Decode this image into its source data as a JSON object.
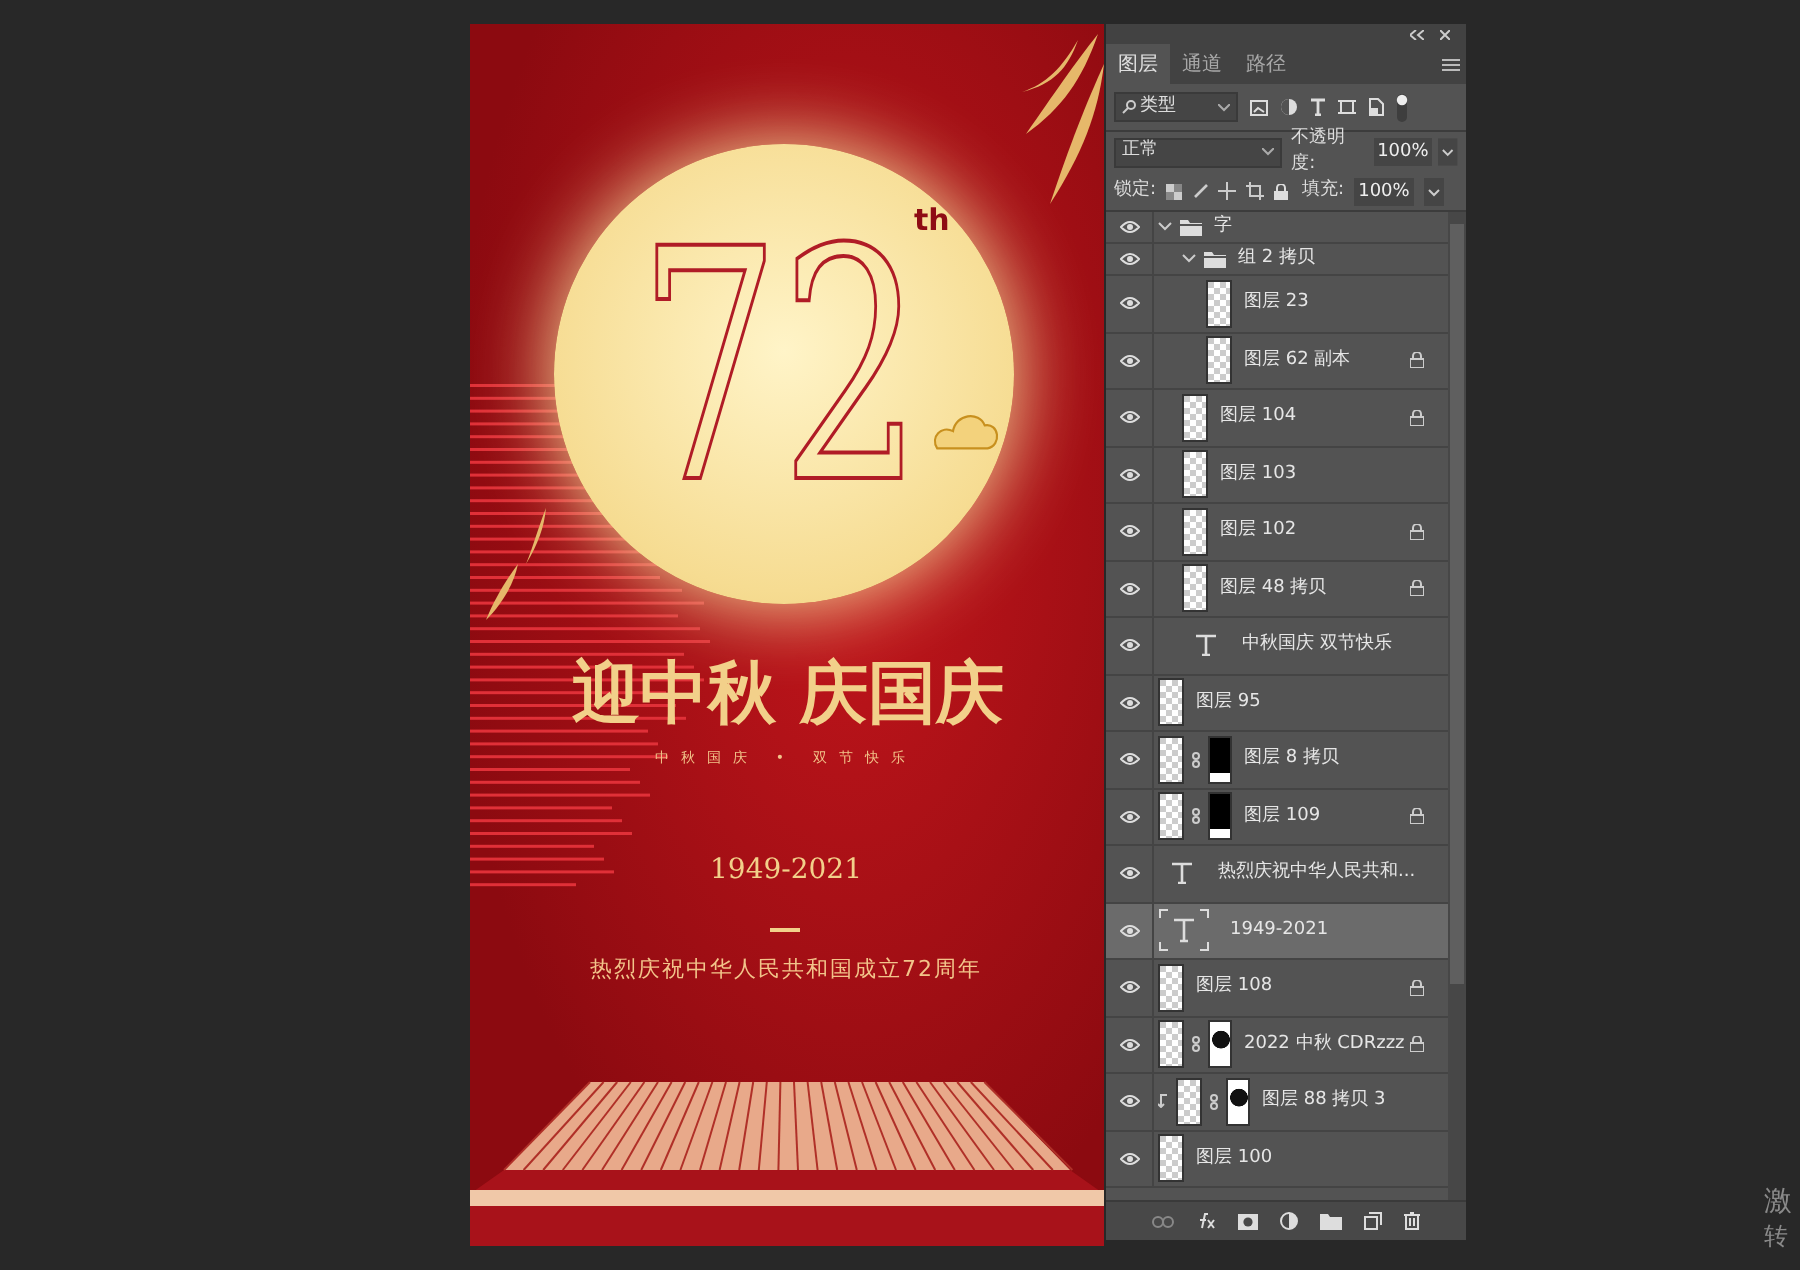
{
  "poster": {
    "number": "72",
    "suffix": "th",
    "headline": "迎中秋 庆国庆",
    "subtitle": "中秋国庆 • 双节快乐",
    "years": "1949-2021",
    "slogan": "热烈庆祝中华人民共和国成立72周年"
  },
  "panel": {
    "tabs": [
      {
        "label": "图层",
        "selected": true
      },
      {
        "label": "通道",
        "selected": false
      },
      {
        "label": "路径",
        "selected": false
      }
    ],
    "filter": "类型",
    "blend_mode": "正常",
    "opacity_label": "不透明度:",
    "opacity": "100%",
    "lock_label": "锁定:",
    "fill_label": "填充:",
    "fill": "100%",
    "layers": [
      {
        "name": "字",
        "kind": "group",
        "expanded": true,
        "selected": false,
        "locked": false,
        "children": [
          {
            "name": "组 2 拷贝",
            "kind": "group",
            "expanded": true,
            "selected": false,
            "locked": false,
            "children": [
              {
                "name": "图层 23",
                "kind": "pixel",
                "selected": false,
                "locked": false
              },
              {
                "name": "图层 62 副本",
                "kind": "pixel",
                "selected": false,
                "locked": true
              }
            ]
          },
          {
            "name": "图层 104",
            "kind": "pixel",
            "selected": false,
            "locked": true
          },
          {
            "name": "图层 103",
            "kind": "pixel",
            "selected": false,
            "locked": false
          },
          {
            "name": "图层 102",
            "kind": "pixel",
            "selected": false,
            "locked": true
          },
          {
            "name": "图层 48 拷贝",
            "kind": "pixel",
            "selected": false,
            "locked": true
          },
          {
            "name": "中秋国庆 双节快乐",
            "kind": "text",
            "selected": false,
            "locked": false
          }
        ]
      },
      {
        "name": "图层 95",
        "kind": "pixel",
        "selected": false,
        "locked": false
      },
      {
        "name": "图层 8 拷贝",
        "kind": "masked",
        "mask_white": false,
        "selected": false,
        "locked": false
      },
      {
        "name": "图层 109",
        "kind": "masked",
        "mask_white": false,
        "selected": false,
        "locked": true
      },
      {
        "name": "热烈庆祝中华人民共和...",
        "kind": "text",
        "selected": false,
        "locked": false
      },
      {
        "name": "1949-2021",
        "kind": "text",
        "selected": true,
        "locked": false
      },
      {
        "name": "图层 108",
        "kind": "pixel",
        "selected": false,
        "locked": true
      },
      {
        "name": "2022 中秋 CDRzzz",
        "kind": "masked",
        "mask_white": true,
        "selected": false,
        "locked": true
      },
      {
        "name": "图层 88 拷贝 3",
        "kind": "masked",
        "mask_white": true,
        "clipped": true,
        "selected": false,
        "locked": false
      },
      {
        "name": "图层 100",
        "kind": "pixel",
        "selected": false,
        "locked": false
      }
    ]
  },
  "activation": {
    "line_1": "激",
    "line_2": "转"
  }
}
